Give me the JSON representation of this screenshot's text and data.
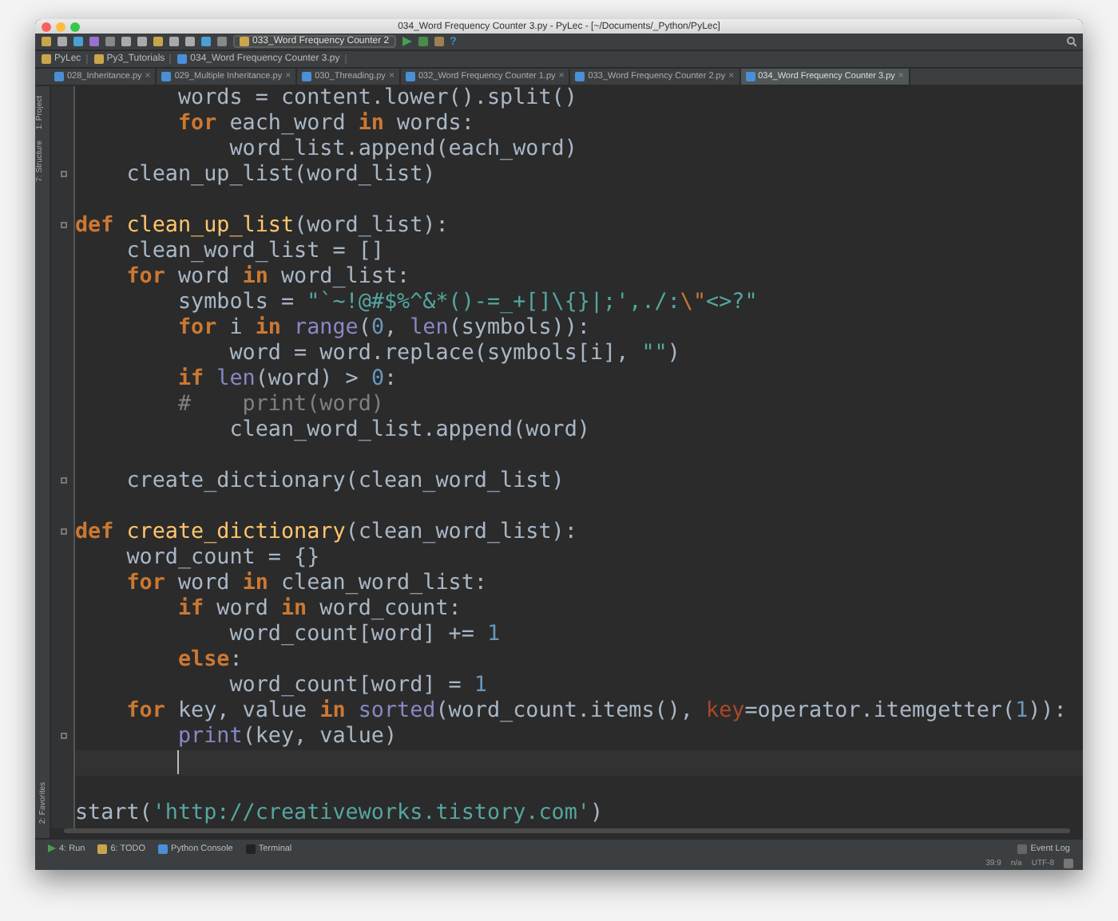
{
  "window": {
    "title": "034_Word Frequency Counter 3.py - PyLec - [~/Documents/_Python/PyLec]"
  },
  "toolbar": {
    "run_config": "033_Word Frequency Counter 2",
    "help": "?"
  },
  "breadcrumbs": [
    "PyLec",
    "Py3_Tutorials",
    "034_Word Frequency Counter 3.py"
  ],
  "tabs": [
    {
      "label": "028_Inheritance.py",
      "close": "×",
      "selected": false
    },
    {
      "label": "029_Multiple Inheritance.py",
      "close": "×",
      "selected": false
    },
    {
      "label": "030_Threading.py",
      "close": "×",
      "selected": false
    },
    {
      "label": "032_Word Frequency Counter 1.py",
      "close": "×",
      "selected": false
    },
    {
      "label": "033_Word Frequency Counter 2.py",
      "close": "×",
      "selected": false
    },
    {
      "label": "034_Word Frequency Counter 3.py",
      "close": "×",
      "selected": true
    }
  ],
  "side_tools": {
    "top": [
      "1: Project",
      "7: Structure"
    ],
    "bottom": [
      "2: Favorites"
    ]
  },
  "code_lines": [
    {
      "kind": "code",
      "tokens": [
        {
          "kind": "plain",
          "text": "        words = content.lower().split()"
        }
      ]
    },
    {
      "kind": "code",
      "tokens": [
        {
          "kind": "keyword",
          "text": "        for"
        },
        {
          "kind": "plain",
          "text": " each_word "
        },
        {
          "kind": "keyword",
          "text": "in"
        },
        {
          "kind": "plain",
          "text": " words:"
        }
      ]
    },
    {
      "kind": "code",
      "tokens": [
        {
          "kind": "plain",
          "text": "            word_list.append(each_word)"
        }
      ]
    },
    {
      "kind": "code",
      "fold": true,
      "tokens": [
        {
          "kind": "plain",
          "text": "    clean_up_list(word_list)"
        }
      ]
    },
    {
      "kind": "blank"
    },
    {
      "kind": "code",
      "fold": true,
      "tokens": [
        {
          "kind": "keyword",
          "text": "def"
        },
        {
          "kind": "function",
          "text": " clean_up_list"
        },
        {
          "kind": "plain",
          "text": "(word_list):"
        }
      ]
    },
    {
      "kind": "code",
      "tokens": [
        {
          "kind": "plain",
          "text": "    clean_word_list = []"
        }
      ]
    },
    {
      "kind": "code",
      "tokens": [
        {
          "kind": "keyword",
          "text": "    for"
        },
        {
          "kind": "plain",
          "text": " word "
        },
        {
          "kind": "keyword",
          "text": "in"
        },
        {
          "kind": "plain",
          "text": " word_list:"
        }
      ]
    },
    {
      "kind": "code",
      "tokens": [
        {
          "kind": "plain",
          "text": "        symbols = "
        },
        {
          "kind": "string",
          "text": "\"`~!@#$%^&*()-=_+[]\\{}|;',./:"
        },
        {
          "kind": "escape",
          "text": "\\\""
        },
        {
          "kind": "string",
          "text": "<>?\""
        }
      ]
    },
    {
      "kind": "code",
      "tokens": [
        {
          "kind": "keyword",
          "text": "        for"
        },
        {
          "kind": "plain",
          "text": " i "
        },
        {
          "kind": "keyword",
          "text": "in"
        },
        {
          "kind": "builtin",
          "text": " range"
        },
        {
          "kind": "plain",
          "text": "("
        },
        {
          "kind": "number",
          "text": "0"
        },
        {
          "kind": "plain",
          "text": ","
        },
        {
          "kind": "builtin",
          "text": " len"
        },
        {
          "kind": "plain",
          "text": "(symbols)):"
        }
      ]
    },
    {
      "kind": "code",
      "tokens": [
        {
          "kind": "plain",
          "text": "            word = word.replace(symbols[i],"
        },
        {
          "kind": "string",
          "text": " \"\""
        },
        {
          "kind": "plain",
          "text": ")"
        }
      ]
    },
    {
      "kind": "code",
      "tokens": [
        {
          "kind": "keyword",
          "text": "        if"
        },
        {
          "kind": "builtin",
          "text": " len"
        },
        {
          "kind": "plain",
          "text": "(word) > "
        },
        {
          "kind": "number",
          "text": "0"
        },
        {
          "kind": "plain",
          "text": ":"
        }
      ]
    },
    {
      "kind": "code",
      "tokens": [
        {
          "kind": "comment",
          "text": "        #    print(word)"
        }
      ]
    },
    {
      "kind": "code",
      "tokens": [
        {
          "kind": "plain",
          "text": "            clean_word_list.append(word)"
        }
      ]
    },
    {
      "kind": "blank"
    },
    {
      "kind": "code",
      "fold": true,
      "tokens": [
        {
          "kind": "plain",
          "text": "    create_dictionary(clean_word_list)"
        }
      ]
    },
    {
      "kind": "blank"
    },
    {
      "kind": "code",
      "fold": true,
      "tokens": [
        {
          "kind": "keyword",
          "text": "def"
        },
        {
          "kind": "function",
          "text": " create_dictionary"
        },
        {
          "kind": "plain",
          "text": "(clean_word_list):"
        }
      ]
    },
    {
      "kind": "code",
      "tokens": [
        {
          "kind": "plain",
          "text": "    word_count = {}"
        }
      ]
    },
    {
      "kind": "code",
      "tokens": [
        {
          "kind": "keyword",
          "text": "    for"
        },
        {
          "kind": "plain",
          "text": " word "
        },
        {
          "kind": "keyword",
          "text": "in"
        },
        {
          "kind": "plain",
          "text": " clean_word_list:"
        }
      ]
    },
    {
      "kind": "code",
      "tokens": [
        {
          "kind": "keyword",
          "text": "        if"
        },
        {
          "kind": "plain",
          "text": " word "
        },
        {
          "kind": "keyword",
          "text": "in"
        },
        {
          "kind": "plain",
          "text": " word_count:"
        }
      ]
    },
    {
      "kind": "code",
      "tokens": [
        {
          "kind": "plain",
          "text": "            word_count[word] += "
        },
        {
          "kind": "number",
          "text": "1"
        }
      ]
    },
    {
      "kind": "code",
      "tokens": [
        {
          "kind": "keyword",
          "text": "        else"
        },
        {
          "kind": "plain",
          "text": ":"
        }
      ]
    },
    {
      "kind": "code",
      "tokens": [
        {
          "kind": "plain",
          "text": "            word_count[word] = "
        },
        {
          "kind": "number",
          "text": "1"
        }
      ]
    },
    {
      "kind": "code",
      "tokens": [
        {
          "kind": "keyword",
          "text": "    for"
        },
        {
          "kind": "plain",
          "text": " key, value "
        },
        {
          "kind": "keyword",
          "text": "in"
        },
        {
          "kind": "builtin",
          "text": " sorted"
        },
        {
          "kind": "plain",
          "text": "(word_count.items(),"
        },
        {
          "kind": "param",
          "text": " key"
        },
        {
          "kind": "plain",
          "text": "=operator.itemgetter("
        },
        {
          "kind": "number",
          "text": "1"
        },
        {
          "kind": "plain",
          "text": ")):"
        }
      ]
    },
    {
      "kind": "code",
      "fold": true,
      "tokens": [
        {
          "kind": "builtin",
          "text": "        print"
        },
        {
          "kind": "plain",
          "text": "(key, value)"
        }
      ]
    },
    {
      "kind": "cursor_line"
    },
    {
      "kind": "blank"
    },
    {
      "kind": "code",
      "tokens": [
        {
          "kind": "plain",
          "text": "start("
        },
        {
          "kind": "string",
          "text": "'http://creativeworks.tistory.com'"
        },
        {
          "kind": "plain",
          "text": ")"
        }
      ]
    }
  ],
  "tool_windows": [
    "4: Run",
    "6: TODO",
    "Python Console",
    "Terminal"
  ],
  "event_log": "Event Log",
  "status_bar": {
    "position": "39:9",
    "vcs": "n/a",
    "encoding": "UTF-8"
  }
}
